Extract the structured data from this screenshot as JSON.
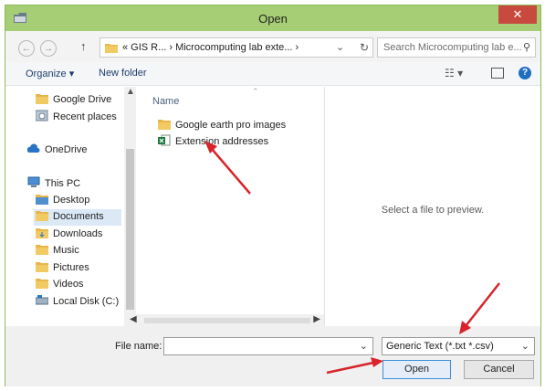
{
  "window": {
    "title": "Open",
    "close_glyph": "✕",
    "accent": "#a6ce74"
  },
  "nav": {
    "back_glyph": "←",
    "forward_glyph": "→",
    "up_glyph": "↑",
    "breadcrumb": "« GIS R...  ›  Microcomputing lab exte...  ›",
    "dropdown_glyph": "⌄",
    "refresh_glyph": "↻",
    "search_placeholder": "Search Microcomputing lab e...",
    "search_glyph": "⚲"
  },
  "toolbar": {
    "organize": "Organize ▾",
    "new_folder": "New folder",
    "view_glyph": "☷ ▾",
    "help_glyph": "?"
  },
  "navpane": {
    "items": [
      {
        "label": "Google Drive",
        "icon": "folder-icon"
      },
      {
        "label": "Recent places",
        "icon": "recent-places-icon"
      },
      {
        "label": "OneDrive",
        "icon": "cloud-icon"
      },
      {
        "label": "This PC",
        "icon": "computer-icon"
      },
      {
        "label": "Desktop",
        "icon": "folder-icon"
      },
      {
        "label": "Documents",
        "icon": "folder-icon",
        "selected": true
      },
      {
        "label": "Downloads",
        "icon": "folder-icon"
      },
      {
        "label": "Music",
        "icon": "folder-icon"
      },
      {
        "label": "Pictures",
        "icon": "folder-icon"
      },
      {
        "label": "Videos",
        "icon": "folder-icon"
      },
      {
        "label": "Local Disk (C:)",
        "icon": "drive-icon"
      }
    ]
  },
  "files": {
    "column_name": "Name",
    "items": [
      {
        "label": "Google earth pro images",
        "icon": "folder-icon"
      },
      {
        "label": "Extension addresses",
        "icon": "excel-file-icon"
      }
    ]
  },
  "preview": {
    "message": "Select a file to preview."
  },
  "bottom": {
    "file_name_label": "File name:",
    "file_name_value": "",
    "file_type": "Generic Text (*.txt *.csv)",
    "open": "Open",
    "cancel": "Cancel"
  },
  "annotation_color": "#d8242a"
}
